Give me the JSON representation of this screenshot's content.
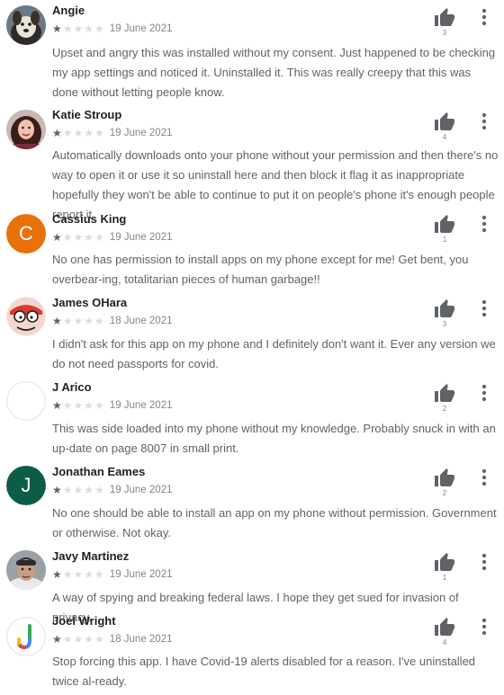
{
  "colors": {
    "name": "#202124",
    "body_text": "#5f6368",
    "date": "#80868b",
    "star_filled": "#5f6368",
    "star_empty": "#dadce0",
    "avatar_cassius": "#e8710a",
    "avatar_jonathan": "#0d5c4a"
  },
  "icons": {
    "helpful": "thumbs-up-icon",
    "menu": "more-vert-icon",
    "star": "star-icon"
  },
  "reviews": [
    {
      "author": "Angie",
      "avatar": "dog-photo",
      "rating": 1,
      "date": "19 June 2021",
      "helpful_count": "3",
      "text": "Upset and angry this was installed without my consent. Just happened to be checking my app settings and noticed it. Uninstalled it. This was really creepy that this was done without letting people know."
    },
    {
      "author": "Katie Stroup",
      "avatar": "woman-photo",
      "rating": 1,
      "date": "19 June 2021",
      "helpful_count": "4",
      "text": "Automatically downloads onto your phone without your permission and then there's no way to open it or use it so uninstall here and then block it flag it as inappropriate hopefully they won't be able to continue to put it on people's phone it's enough people report it"
    },
    {
      "author": "Cassius King",
      "avatar": "C",
      "rating": 1,
      "date": "19 June 2021",
      "helpful_count": "1",
      "text": "No one has permission to install apps on my phone except for me! Get bent, you overbear-ing, totalitarian pieces of human garbage!!"
    },
    {
      "author": "James OHara",
      "avatar": "cartoon-character",
      "rating": 1,
      "date": "18 June 2021",
      "helpful_count": "3",
      "text": "I didn't ask for this app on my phone and I definitely don't want it. Ever any version we do not need passports for covid."
    },
    {
      "author": "J Arico",
      "avatar": "blank",
      "rating": 1,
      "date": "19 June 2021",
      "helpful_count": "2",
      "text": "This was side loaded into my phone without my knowledge. Probably snuck in with an up-date on page 8007 in small print."
    },
    {
      "author": "Jonathan Eames",
      "avatar": "J",
      "rating": 1,
      "date": "19 June 2021",
      "helpful_count": "2",
      "text": "No one should be able to install an app on my phone without permission. Government or otherwise. Not okay."
    },
    {
      "author": "Javy Martinez",
      "avatar": "man-photo",
      "rating": 1,
      "date": "19 June 2021",
      "helpful_count": "1",
      "text": "A way of spying and breaking federal laws. I hope they get sued for invasion of privacy."
    },
    {
      "author": "Joel Wright",
      "avatar": "google-logo",
      "rating": 1,
      "date": "18 June 2021",
      "helpful_count": "4",
      "text": "Stop forcing this app. I have Covid-19 alerts disabled for a reason. I've uninstalled twice al-ready."
    }
  ]
}
